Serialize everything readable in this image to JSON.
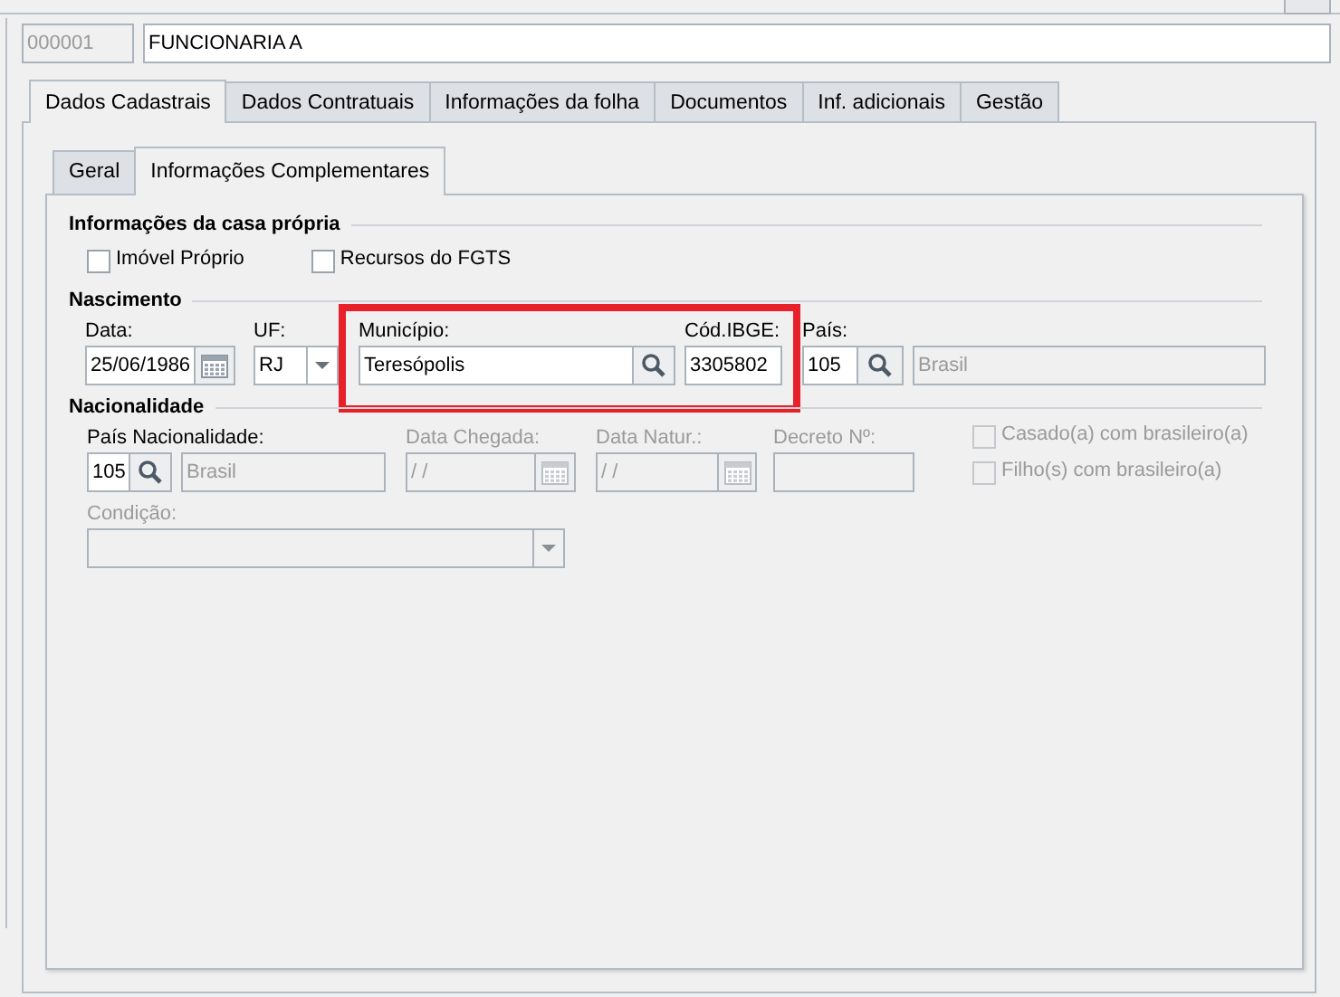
{
  "record": {
    "code": "000001",
    "name": "FUNCIONARIA A"
  },
  "tabs": [
    {
      "label": "Dados Cadastrais",
      "selected": true
    },
    {
      "label": "Dados Contratuais",
      "selected": false
    },
    {
      "label": "Informações da folha",
      "selected": false
    },
    {
      "label": "Documentos",
      "selected": false
    },
    {
      "label": "Inf. adicionais",
      "selected": false
    },
    {
      "label": "Gestão",
      "selected": false
    }
  ],
  "subtabs": [
    {
      "label": "Geral",
      "selected": false
    },
    {
      "label": "Informações Complementares",
      "selected": true
    }
  ],
  "sections": [
    {
      "title": "Informações da casa própria",
      "rows": [
        [
          {
            "kind": "checkbox",
            "label": "Imóvel Próprio",
            "checked": false
          },
          {
            "kind": "checkbox",
            "label": "Recursos do FGTS",
            "checked": false
          }
        ]
      ]
    },
    {
      "title": "Nascimento",
      "rows": [
        [
          {
            "kind": "date",
            "label": "Data:",
            "value": "25/06/1986"
          },
          {
            "kind": "combo",
            "label": "UF:",
            "value": "RJ"
          },
          {
            "kind": "lookup",
            "label": "Município:",
            "value": "Teresópolis",
            "highlighted": true
          },
          {
            "kind": "text",
            "label": "Cód.IBGE:",
            "value": "3305802",
            "highlighted": true
          },
          {
            "kind": "lookup",
            "label": "País:",
            "value": "105"
          },
          {
            "kind": "text",
            "value": "Brasil",
            "disabled": true
          }
        ]
      ]
    },
    {
      "title": "Nacionalidade",
      "rows": [
        [
          {
            "kind": "lookup",
            "label": "País Nacionalidade:",
            "value": "105"
          },
          {
            "kind": "text",
            "value": "Brasil",
            "disabled": true
          },
          {
            "kind": "date",
            "label": "Data Chegada:",
            "value": "/ /",
            "disabled": true
          },
          {
            "kind": "date",
            "label": "Data Natur.:",
            "value": "/ /",
            "disabled": true
          },
          {
            "kind": "text",
            "label": "Decreto Nº:",
            "disabled": true
          },
          {
            "kind": "checks",
            "items": [
              {
                "label": "Casado(a) com brasileiro(a)",
                "checked": false,
                "disabled": true
              },
              {
                "label": "Filho(s) com brasileiro(a)",
                "checked": false,
                "disabled": true
              }
            ]
          }
        ],
        [
          {
            "kind": "combo",
            "label": "Condição:",
            "disabled": true
          }
        ]
      ]
    }
  ]
}
